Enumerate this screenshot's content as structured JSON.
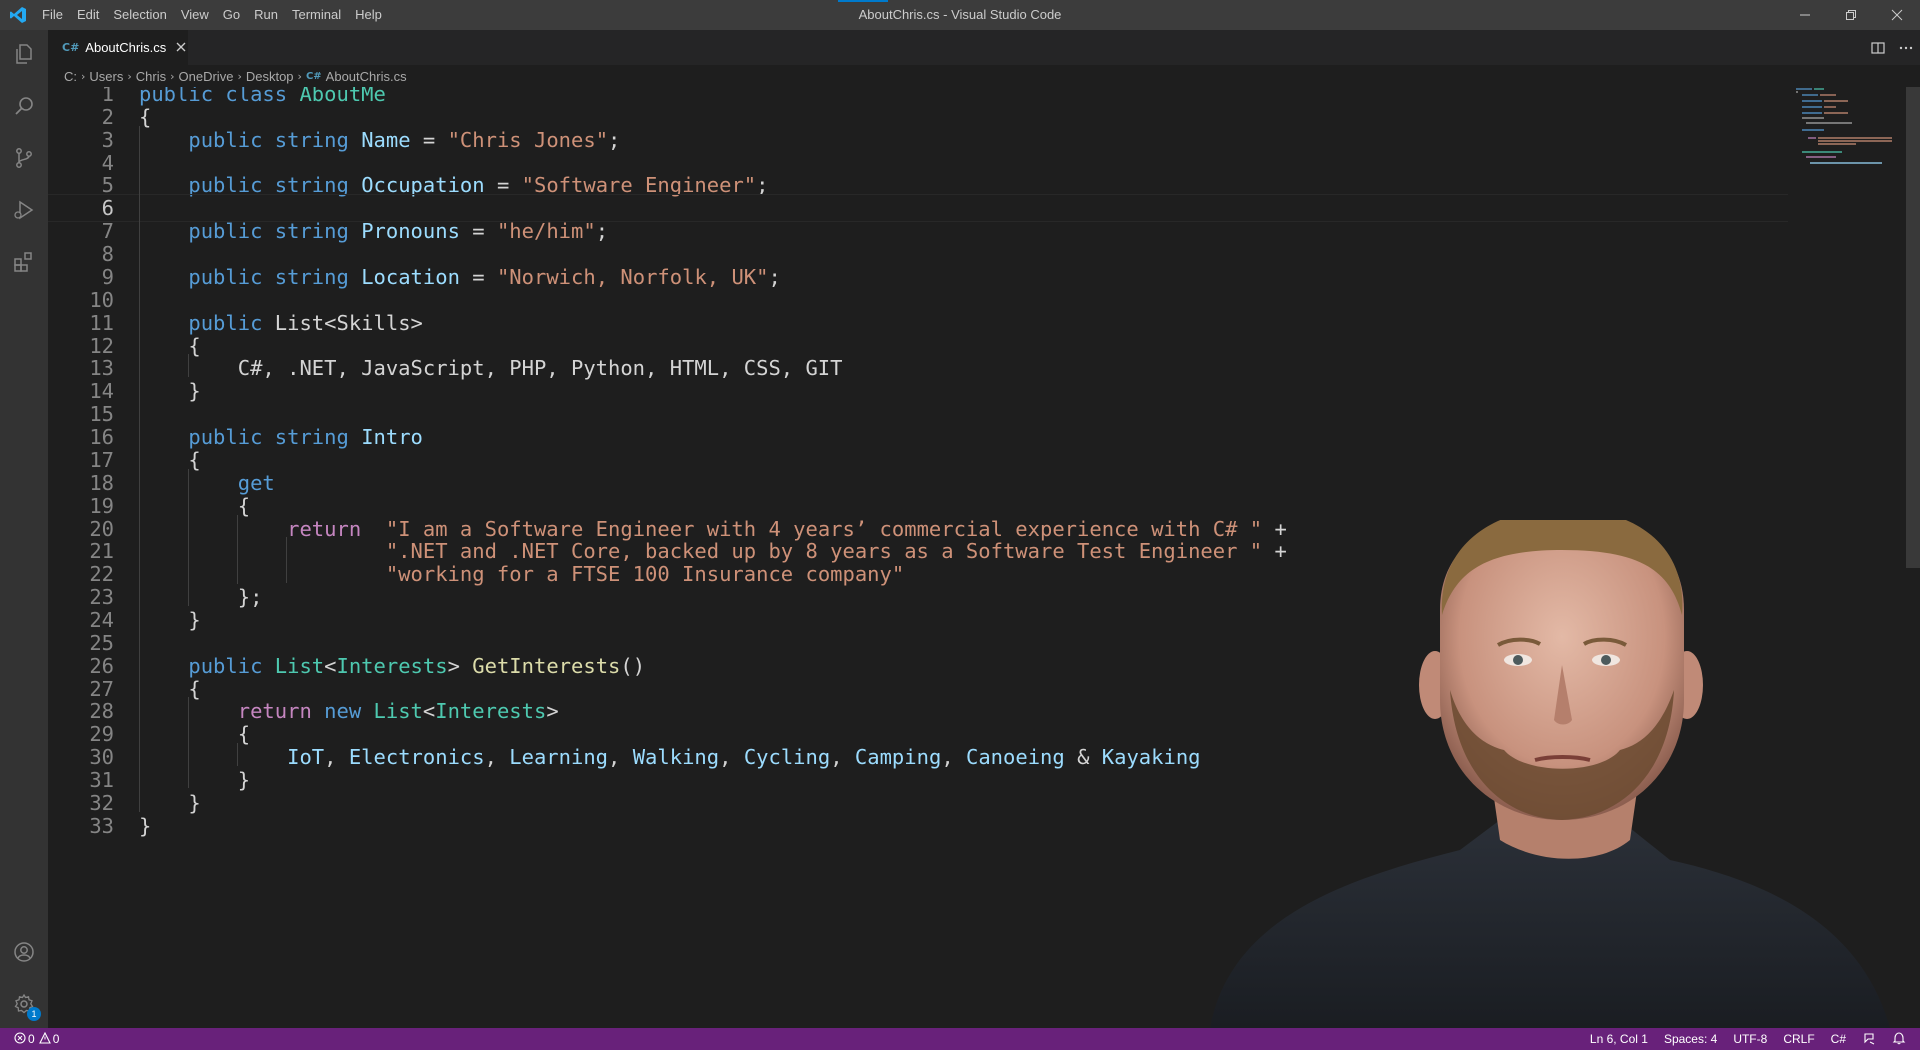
{
  "window": {
    "title": "AboutChris.cs - Visual Studio Code",
    "menus": [
      "File",
      "Edit",
      "Selection",
      "View",
      "Go",
      "Run",
      "Terminal",
      "Help"
    ]
  },
  "activitybar": {
    "items": [
      "explorer-icon",
      "search-icon",
      "source-control-icon",
      "run-debug-icon",
      "extensions-icon"
    ],
    "bottom": [
      "accounts-icon",
      "manage-gear-icon"
    ],
    "manage_badge": "1"
  },
  "tab": {
    "icon": "C#",
    "label": "AboutChris.cs"
  },
  "breadcrumb": {
    "parts": [
      "C:",
      "Users",
      "Chris",
      "OneDrive",
      "Desktop"
    ],
    "file_icon": "C#",
    "file": "AboutChris.cs"
  },
  "editor": {
    "active_line": 6,
    "lines": [
      [
        {
          "t": "public",
          "c": "kw"
        },
        {
          "t": " ",
          "c": "plain"
        },
        {
          "t": "class",
          "c": "kw"
        },
        {
          "t": " ",
          "c": "plain"
        },
        {
          "t": "AboutMe",
          "c": "cls"
        }
      ],
      [
        {
          "t": "{",
          "c": "plain"
        }
      ],
      [
        {
          "t": "    ",
          "c": "plain"
        },
        {
          "t": "public",
          "c": "kw"
        },
        {
          "t": " ",
          "c": "plain"
        },
        {
          "t": "string",
          "c": "kw"
        },
        {
          "t": " ",
          "c": "plain"
        },
        {
          "t": "Name",
          "c": "prop"
        },
        {
          "t": " = ",
          "c": "plain"
        },
        {
          "t": "\"Chris Jones\"",
          "c": "str"
        },
        {
          "t": ";",
          "c": "plain"
        }
      ],
      [],
      [
        {
          "t": "    ",
          "c": "plain"
        },
        {
          "t": "public",
          "c": "kw"
        },
        {
          "t": " ",
          "c": "plain"
        },
        {
          "t": "string",
          "c": "kw"
        },
        {
          "t": " ",
          "c": "plain"
        },
        {
          "t": "Occupation",
          "c": "prop"
        },
        {
          "t": " = ",
          "c": "plain"
        },
        {
          "t": "\"Software Engineer\"",
          "c": "str"
        },
        {
          "t": ";",
          "c": "plain"
        }
      ],
      [],
      [
        {
          "t": "    ",
          "c": "plain"
        },
        {
          "t": "public",
          "c": "kw"
        },
        {
          "t": " ",
          "c": "plain"
        },
        {
          "t": "string",
          "c": "kw"
        },
        {
          "t": " ",
          "c": "plain"
        },
        {
          "t": "Pronouns",
          "c": "prop"
        },
        {
          "t": " = ",
          "c": "plain"
        },
        {
          "t": "\"he/him\"",
          "c": "str"
        },
        {
          "t": ";",
          "c": "plain"
        }
      ],
      [],
      [
        {
          "t": "    ",
          "c": "plain"
        },
        {
          "t": "public",
          "c": "kw"
        },
        {
          "t": " ",
          "c": "plain"
        },
        {
          "t": "string",
          "c": "kw"
        },
        {
          "t": " ",
          "c": "plain"
        },
        {
          "t": "Location",
          "c": "prop"
        },
        {
          "t": " = ",
          "c": "plain"
        },
        {
          "t": "\"Norwich, Norfolk, UK\"",
          "c": "str"
        },
        {
          "t": ";",
          "c": "plain"
        }
      ],
      [],
      [
        {
          "t": "    ",
          "c": "plain"
        },
        {
          "t": "public",
          "c": "kw"
        },
        {
          "t": " List<Skills>",
          "c": "plain"
        }
      ],
      [
        {
          "t": "    {",
          "c": "plain"
        }
      ],
      [
        {
          "t": "        C#, .NET, JavaScript, PHP, Python, HTML, CSS, GIT",
          "c": "plain"
        }
      ],
      [
        {
          "t": "    }",
          "c": "plain"
        }
      ],
      [],
      [
        {
          "t": "    ",
          "c": "plain"
        },
        {
          "t": "public",
          "c": "kw"
        },
        {
          "t": " ",
          "c": "plain"
        },
        {
          "t": "string",
          "c": "kw"
        },
        {
          "t": " ",
          "c": "plain"
        },
        {
          "t": "Intro",
          "c": "prop"
        }
      ],
      [
        {
          "t": "    {",
          "c": "plain"
        }
      ],
      [
        {
          "t": "        ",
          "c": "plain"
        },
        {
          "t": "get",
          "c": "kw"
        }
      ],
      [
        {
          "t": "        {",
          "c": "plain"
        }
      ],
      [
        {
          "t": "            ",
          "c": "plain"
        },
        {
          "t": "return",
          "c": "ctl"
        },
        {
          "t": "  ",
          "c": "plain"
        },
        {
          "t": "\"I am a Software Engineer with 4 years’ commercial experience with C# \"",
          "c": "str"
        },
        {
          "t": " +",
          "c": "plain"
        }
      ],
      [
        {
          "t": "                    ",
          "c": "plain"
        },
        {
          "t": "\".NET and .NET Core, backed up by 8 years as a Software Test Engineer \"",
          "c": "str"
        },
        {
          "t": " +",
          "c": "plain"
        }
      ],
      [
        {
          "t": "                    ",
          "c": "plain"
        },
        {
          "t": "\"working for a FTSE 100 Insurance company\"",
          "c": "str"
        }
      ],
      [
        {
          "t": "        };",
          "c": "plain"
        }
      ],
      [
        {
          "t": "    }",
          "c": "plain"
        }
      ],
      [],
      [
        {
          "t": "    ",
          "c": "plain"
        },
        {
          "t": "public",
          "c": "kw"
        },
        {
          "t": " ",
          "c": "plain"
        },
        {
          "t": "List",
          "c": "cls"
        },
        {
          "t": "<",
          "c": "plain"
        },
        {
          "t": "Interests",
          "c": "cls"
        },
        {
          "t": "> ",
          "c": "plain"
        },
        {
          "t": "GetInterests",
          "c": "fn"
        },
        {
          "t": "()",
          "c": "plain"
        }
      ],
      [
        {
          "t": "    {",
          "c": "plain"
        }
      ],
      [
        {
          "t": "        ",
          "c": "plain"
        },
        {
          "t": "return",
          "c": "ctl"
        },
        {
          "t": " ",
          "c": "plain"
        },
        {
          "t": "new",
          "c": "kw"
        },
        {
          "t": " ",
          "c": "plain"
        },
        {
          "t": "List",
          "c": "cls"
        },
        {
          "t": "<",
          "c": "plain"
        },
        {
          "t": "Interests",
          "c": "cls"
        },
        {
          "t": ">",
          "c": "plain"
        }
      ],
      [
        {
          "t": "        {",
          "c": "plain"
        }
      ],
      [
        {
          "t": "            ",
          "c": "plain"
        },
        {
          "t": "IoT",
          "c": "prop"
        },
        {
          "t": ", ",
          "c": "plain"
        },
        {
          "t": "Electronics",
          "c": "prop"
        },
        {
          "t": ", ",
          "c": "plain"
        },
        {
          "t": "Learning",
          "c": "prop"
        },
        {
          "t": ", ",
          "c": "plain"
        },
        {
          "t": "Walking",
          "c": "prop"
        },
        {
          "t": ", ",
          "c": "plain"
        },
        {
          "t": "Cycling",
          "c": "prop"
        },
        {
          "t": ", ",
          "c": "plain"
        },
        {
          "t": "Camping",
          "c": "prop"
        },
        {
          "t": ", ",
          "c": "plain"
        },
        {
          "t": "Canoeing",
          "c": "prop"
        },
        {
          "t": " & ",
          "c": "plain"
        },
        {
          "t": "Kayaking",
          "c": "prop"
        }
      ],
      [
        {
          "t": "        }",
          "c": "plain"
        }
      ],
      [
        {
          "t": "    }",
          "c": "plain"
        }
      ],
      [
        {
          "t": "}",
          "c": "plain"
        }
      ]
    ]
  },
  "statusbar": {
    "errors": "0",
    "warnings": "0",
    "position": "Ln 6, Col 1",
    "indent": "Spaces: 4",
    "encoding": "UTF-8",
    "eol": "CRLF",
    "language": "C#"
  },
  "colors": {
    "statusbar": "#68217a",
    "keyword": "#569cd6",
    "type": "#4ec9b0",
    "string": "#ce9178",
    "identifier": "#9cdcfe",
    "control": "#c586c0",
    "function": "#dcdcaa"
  }
}
